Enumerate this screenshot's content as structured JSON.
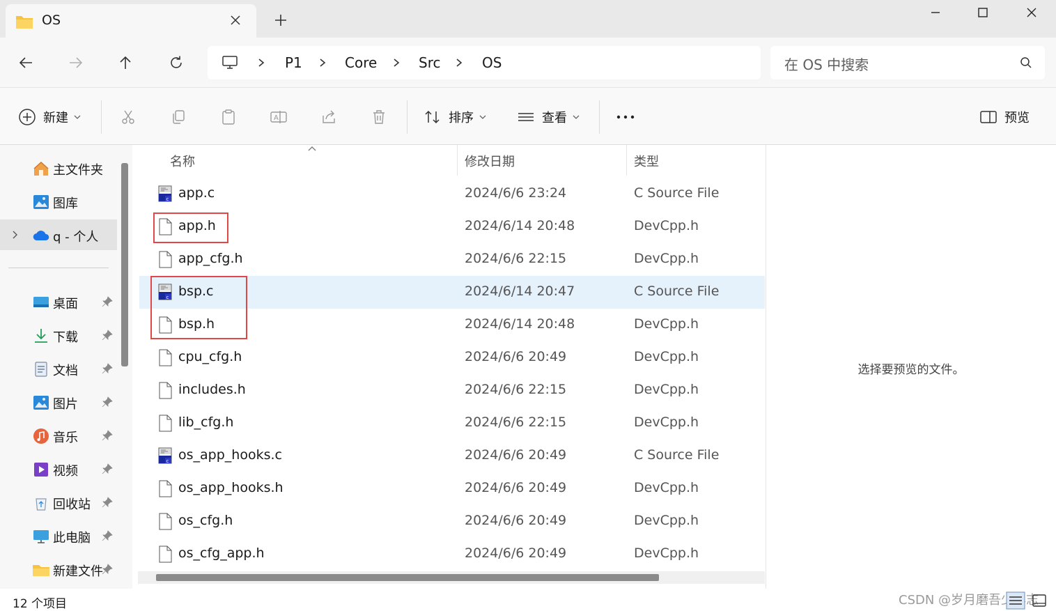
{
  "window": {
    "tab_title": "OS",
    "tab_close": "close-icon",
    "new_tab": "plus-icon",
    "controls": [
      "minimize-icon",
      "maximize-icon",
      "close-icon"
    ]
  },
  "nav": {
    "back": "arrow-left-icon",
    "forward": "arrow-right-icon",
    "up": "arrow-up-icon",
    "refresh": "refresh-icon"
  },
  "breadcrumb": [
    "P1",
    "Core",
    "Src",
    "OS"
  ],
  "search": {
    "placeholder": "在 OS 中搜索"
  },
  "toolbar": {
    "new_label": "新建",
    "sort_label": "排序",
    "view_label": "查看",
    "more": "...",
    "preview_label": "预览",
    "icons": [
      "cut-icon",
      "copy-icon",
      "paste-icon",
      "rename-icon",
      "share-icon",
      "delete-icon"
    ]
  },
  "sidebar": {
    "items": [
      {
        "label": "主文件夹",
        "icon": "home-icon"
      },
      {
        "label": "图库",
        "icon": "gallery-icon"
      },
      {
        "label": "q - 个人",
        "icon": "cloud-icon"
      },
      {
        "label": "桌面",
        "icon": "desktop-icon"
      },
      {
        "label": "下载",
        "icon": "download-icon"
      },
      {
        "label": "文档",
        "icon": "document-icon"
      },
      {
        "label": "图片",
        "icon": "pictures-icon"
      },
      {
        "label": "音乐",
        "icon": "music-icon"
      },
      {
        "label": "视频",
        "icon": "video-icon"
      },
      {
        "label": "回收站",
        "icon": "recycle-bin-icon"
      },
      {
        "label": "此电脑",
        "icon": "computer-icon"
      },
      {
        "label": "新建文件夹",
        "icon": "folder-icon"
      }
    ]
  },
  "columns": {
    "name": "名称",
    "date": "修改日期",
    "type": "类型"
  },
  "files": [
    {
      "name": "app.c",
      "date": "2024/6/6 23:24",
      "type": "C Source File",
      "kind": "c"
    },
    {
      "name": "app.h",
      "date": "2024/6/14 20:48",
      "type": "DevCpp.h",
      "kind": "h"
    },
    {
      "name": "app_cfg.h",
      "date": "2024/6/6 22:15",
      "type": "DevCpp.h",
      "kind": "h"
    },
    {
      "name": "bsp.c",
      "date": "2024/6/14 20:47",
      "type": "C Source File",
      "kind": "c"
    },
    {
      "name": "bsp.h",
      "date": "2024/6/14 20:48",
      "type": "DevCpp.h",
      "kind": "h"
    },
    {
      "name": "cpu_cfg.h",
      "date": "2024/6/6 20:49",
      "type": "DevCpp.h",
      "kind": "h"
    },
    {
      "name": "includes.h",
      "date": "2024/6/6 22:15",
      "type": "DevCpp.h",
      "kind": "h"
    },
    {
      "name": "lib_cfg.h",
      "date": "2024/6/6 22:15",
      "type": "DevCpp.h",
      "kind": "h"
    },
    {
      "name": "os_app_hooks.c",
      "date": "2024/6/6 20:49",
      "type": "C Source File",
      "kind": "c"
    },
    {
      "name": "os_app_hooks.h",
      "date": "2024/6/6 20:49",
      "type": "DevCpp.h",
      "kind": "h"
    },
    {
      "name": "os_cfg.h",
      "date": "2024/6/6 20:49",
      "type": "DevCpp.h",
      "kind": "h"
    },
    {
      "name": "os_cfg_app.h",
      "date": "2024/6/6 20:49",
      "type": "DevCpp.h",
      "kind": "h"
    }
  ],
  "selected_file": "bsp.c",
  "preview": {
    "message": "选择要预览的文件。"
  },
  "status": {
    "count": "12 个项目",
    "watermark": "CSDN @岁月磨吾少年志"
  },
  "colors": {
    "accent": "#0067c0",
    "selection": "#e5f1fb",
    "highlight_box": "#e04848"
  }
}
